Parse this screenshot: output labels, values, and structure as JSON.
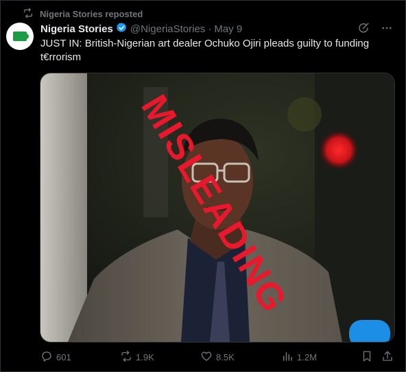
{
  "repost": {
    "label": "Nigeria Stories reposted"
  },
  "author": {
    "name": "Nigeria Stories",
    "handle": "@NigeriaStories",
    "separator": "·",
    "date": "May 9"
  },
  "tweet": {
    "text": "JUST IN: British-Nigerian art dealer Ochuko Ojiri pleads guilty to funding t€rrorism"
  },
  "media": {
    "overlay_text": "MISLEADING"
  },
  "actions": {
    "replies": "601",
    "reposts": "1.9K",
    "likes": "8.5K",
    "views": "1.2M"
  },
  "colors": {
    "background": "#000000",
    "text": "#e7e9ea",
    "muted": "#71767b",
    "verified": "#1d9bf0",
    "overlay": "#e8192c"
  },
  "icons": [
    "repost-icon",
    "verified-badge-icon",
    "grok-icon",
    "more-icon",
    "reply-icon",
    "like-icon",
    "views-icon",
    "bookmark-icon",
    "share-icon"
  ]
}
